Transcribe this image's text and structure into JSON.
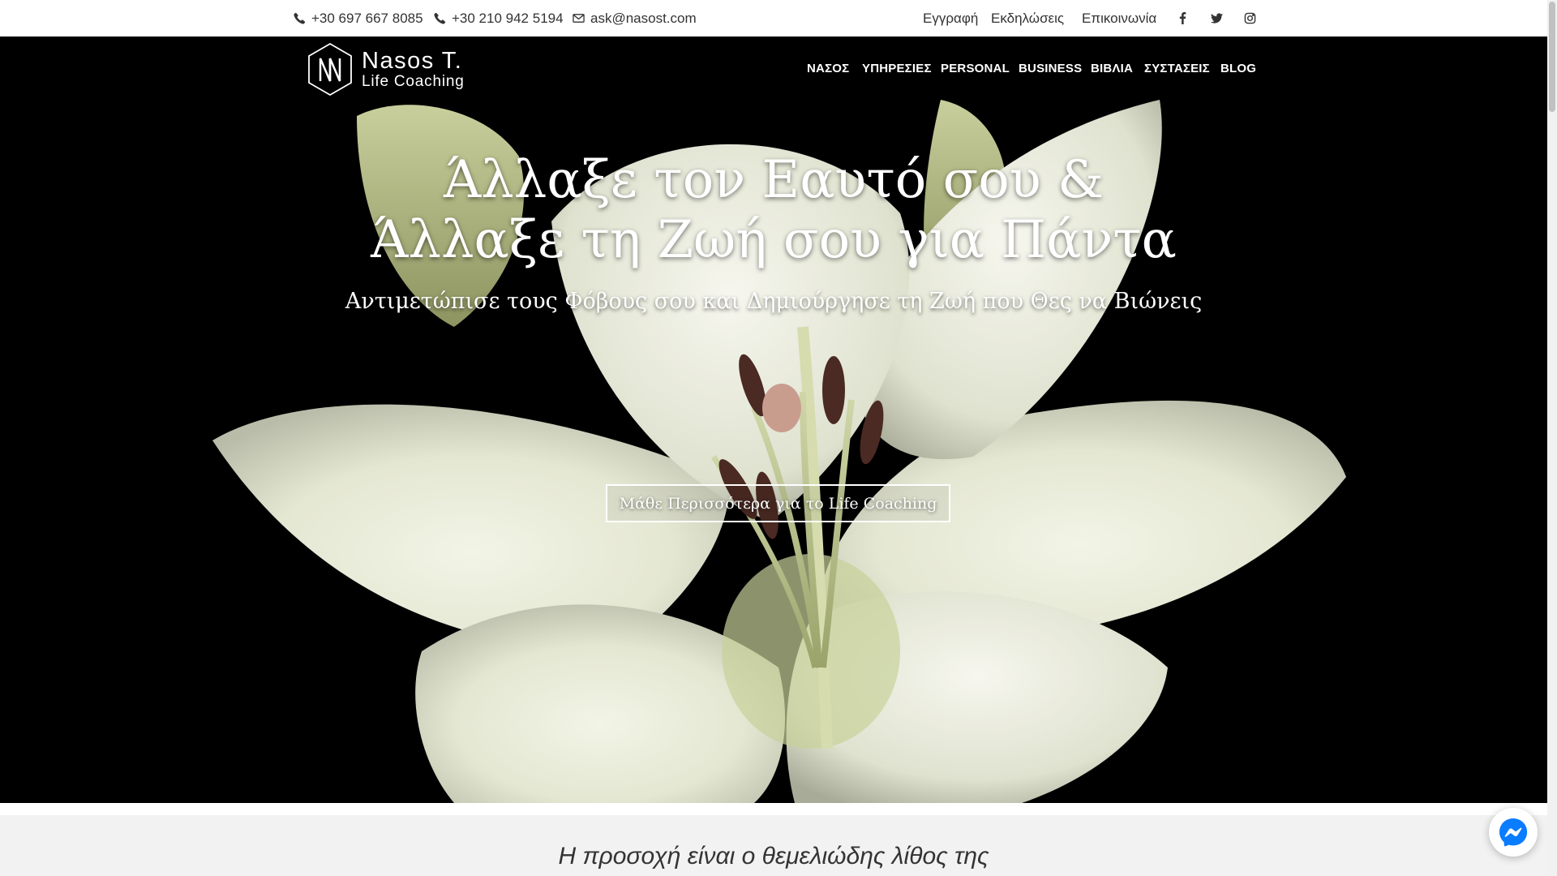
{
  "topbar": {
    "phone1": "+30 697 667 8085",
    "phone2": "+30 210 942 5194",
    "email": "ask@nasost.com",
    "links": [
      "Εγγραφή",
      "Εκδηλώσεις",
      "Επικοινωνία"
    ],
    "social_icons": [
      "facebook-icon",
      "twitter-icon",
      "instagram-icon"
    ]
  },
  "logo": {
    "title": "Nasos T.",
    "subtitle": "Life Coaching"
  },
  "nav": {
    "items": [
      "ΝΑΣΟΣ",
      "ΥΠΗΡΕΣΙΕΣ",
      "PERSONAL",
      "BUSINESS",
      "ΒΙΒΛΙΑ",
      "ΣΥΣΤΑΣΕΙΣ",
      "BLOG"
    ]
  },
  "hero": {
    "title_line1": "Άλλαξε τον Εαυτό σου &",
    "title_line2": "Άλλαξε τη Ζωή σου για Πάντα",
    "subtitle": "Αντιμετώπισε τους Φόβους σου και Δημιούργησε τη Ζωή που Θες να Βιώνεις",
    "cta_label": "Μάθε Περισσότερα για το Life Coaching"
  },
  "section2": {
    "quote": "Η προσοχή είναι ο θεμελιώδης λίθος της"
  },
  "colors": {
    "header_bg": "#000000",
    "topbar_bg": "#ffffff",
    "section_bg": "#f2f2f2",
    "messenger_blue": "#0a7cff"
  }
}
